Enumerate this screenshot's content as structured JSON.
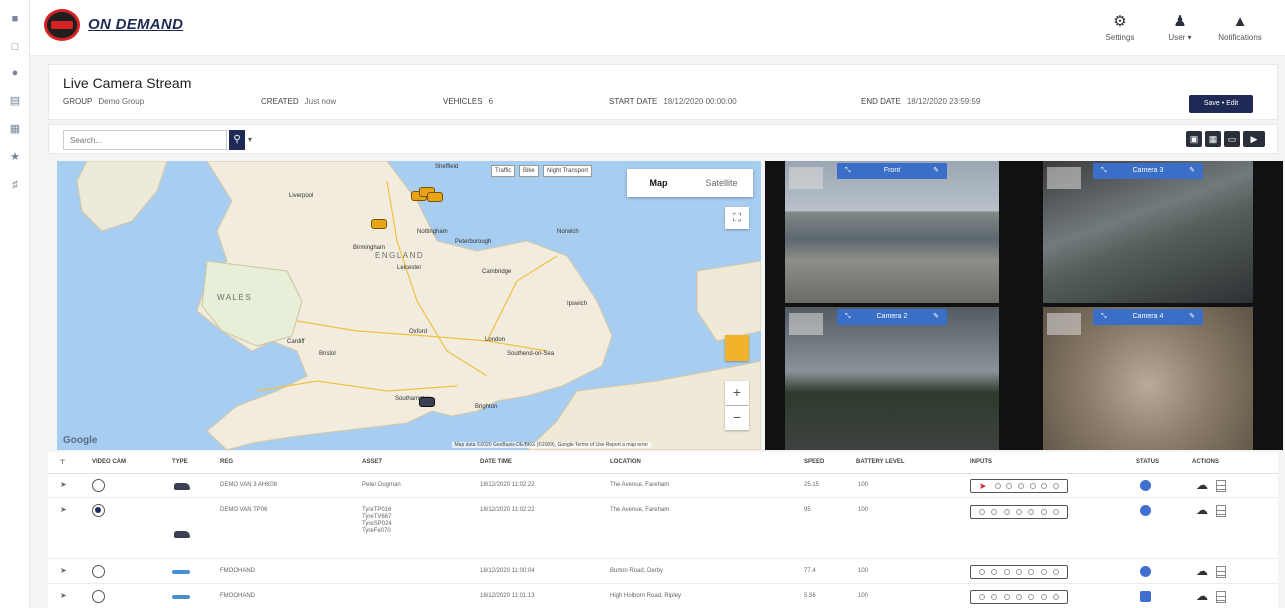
{
  "app": {
    "brand": "ON DEMAND"
  },
  "rail": {
    "icons": [
      "grid-icon",
      "monitor-icon",
      "location-pin-icon",
      "list-icon",
      "table-icon",
      "star-icon",
      "wrench-icon"
    ]
  },
  "header": {
    "settings_label": "Settings",
    "user_label": "User ▾",
    "notifications_label": "Notifications"
  },
  "info": {
    "title": "Live Camera Stream",
    "group_label": "GROUP",
    "group_value": "Demo Group",
    "created_label": "CREATED",
    "created_value": "Just now",
    "vehicles_label": "VEHICLES",
    "vehicles_value": "6",
    "start_label": "START DATE",
    "start_value": "18/12/2020 00:00:00",
    "end_label": "END DATE",
    "end_value": "18/12/2020 23:59:59",
    "save_label": "Save • Edit"
  },
  "search": {
    "placeholder": "Search..."
  },
  "map": {
    "tabs": [
      "Map",
      "Satellite"
    ],
    "layers": [
      "Traffic",
      "Bike",
      "Night Transport"
    ],
    "region_labels": [
      "ENGLAND",
      "WALES"
    ],
    "cities": [
      "Sheffield",
      "Liverpool",
      "Birmingham",
      "Peterborough",
      "Norwich",
      "Cambridge",
      "London",
      "Southend-on-Sea",
      "Cardiff",
      "Bristol",
      "Southampton",
      "Brighton",
      "Leicester",
      "Nottingham",
      "Ipswich",
      "Oxford"
    ],
    "attribution": "Map data ©2020 GeoBasis-DE/BKG (©2009), Google  Terms of Use  Report a map error",
    "google": "Google"
  },
  "cameras": [
    {
      "name": "Front"
    },
    {
      "name": "Camera 3"
    },
    {
      "name": "Camera 2"
    },
    {
      "name": "Camera 4"
    }
  ],
  "table": {
    "headers": [
      "VIDEO CAM",
      "TYPE",
      "REG",
      "ASSET",
      "DATE TIME",
      "LOCATION",
      "SPEED",
      "BATTERY LEVEL",
      "INPUTS",
      "STATUS",
      "ACTIONS"
    ],
    "rows": [
      {
        "reg": "DEMO VAN 3 AHK08",
        "asset": "Peter Dugman",
        "datetime": "18/12/2020 11:02:22",
        "location": "The Avenue, Fareham",
        "speed": "25.15",
        "battery": "100"
      },
      {
        "reg": "DEMO VAN TP06",
        "asset": "TyreTP016\nTyreTV667\nTyreSP024\nTyreFe070",
        "datetime": "18/12/2020 11:02:22",
        "location": "The Avenue, Fareham",
        "speed": "95",
        "battery": "100"
      },
      {
        "reg": "FMOOHAND",
        "asset": "",
        "datetime": "18/12/2020 11:00:04",
        "location": "Burton Road, Derby",
        "speed": "77.4",
        "battery": "100"
      },
      {
        "reg": "FMOOHAND",
        "asset": "",
        "datetime": "18/12/2020 11:01:13",
        "location": "High Holborn Road, Ripley",
        "speed": "5.56",
        "battery": "100"
      }
    ]
  }
}
